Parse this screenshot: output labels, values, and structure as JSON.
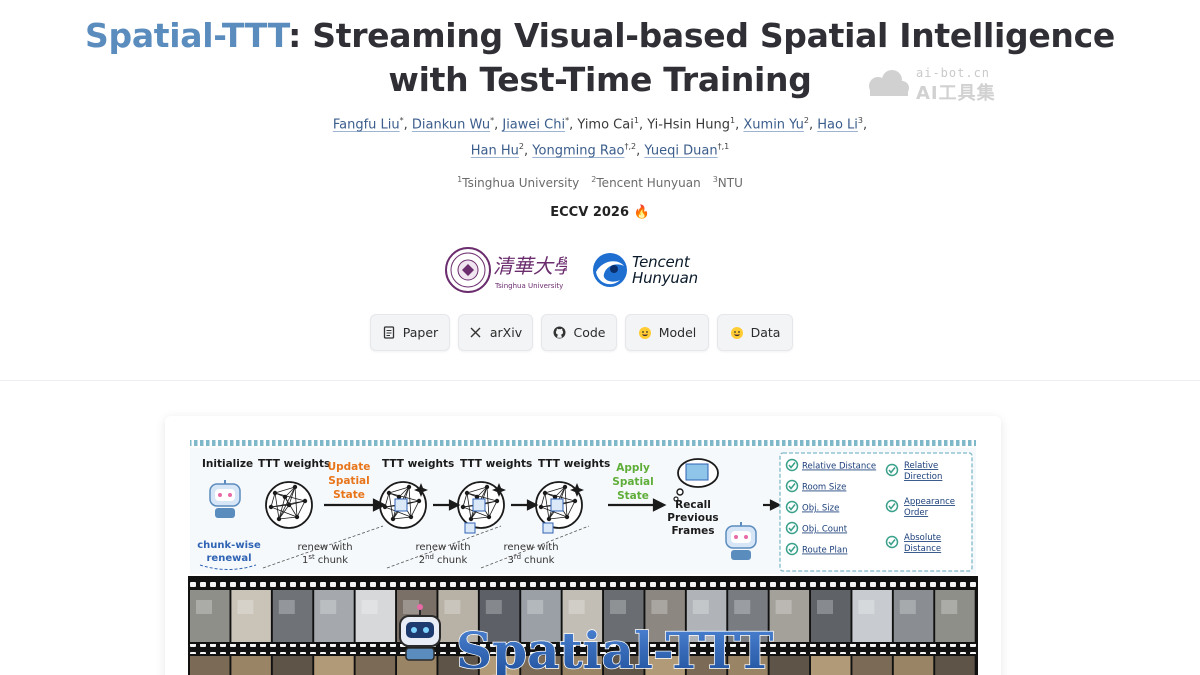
{
  "title": {
    "accent": "Spatial-TTT",
    "rest_line1": ": Streaming Visual-based Spatial Intelligence",
    "line2": "with Test-Time Training"
  },
  "watermark": {
    "line1": "ai-bot.cn",
    "line2": "AI工具集"
  },
  "authors": {
    "line1": [
      {
        "name": "Fangfu Liu",
        "sup": "*",
        "link": true,
        "sep": ", "
      },
      {
        "name": "Diankun Wu",
        "sup": "*",
        "link": true,
        "sep": ", "
      },
      {
        "name": "Jiawei Chi",
        "sup": "*",
        "link": true,
        "sep": ", "
      },
      {
        "name": "Yimo Cai",
        "sup": "1",
        "link": false,
        "sep": ", "
      },
      {
        "name": "Yi-Hsin Hung",
        "sup": "1",
        "link": false,
        "sep": ", "
      },
      {
        "name": "Xumin Yu",
        "sup": "2",
        "link": true,
        "sep": ", "
      },
      {
        "name": "Hao Li",
        "sup": "3",
        "link": true,
        "sep": ","
      }
    ],
    "line2": [
      {
        "name": "Han Hu",
        "sup": "2",
        "link": true,
        "sep": ", "
      },
      {
        "name": "Yongming Rao",
        "sup": "†,2",
        "link": true,
        "sep": ", "
      },
      {
        "name": "Yueqi Duan",
        "sup": "†,1",
        "link": true,
        "sep": ""
      }
    ]
  },
  "affiliations": [
    {
      "sup": "1",
      "name": "Tsinghua University"
    },
    {
      "sup": "2",
      "name": "Tencent Hunyuan"
    },
    {
      "sup": "3",
      "name": "NTU"
    }
  ],
  "venue": "ECCV 2026 🔥",
  "logos": {
    "tsinghua_cn": "清華大學",
    "tsinghua_en": "Tsinghua University",
    "tencent_line1": "Tencent",
    "tencent_line2": "Hunyuan"
  },
  "buttons": [
    {
      "label": "Paper",
      "icon": "document-icon"
    },
    {
      "label": "arXiv",
      "icon": "x-icon"
    },
    {
      "label": "Code",
      "icon": "github-icon"
    },
    {
      "label": "Model",
      "icon": "hugging-face-icon"
    },
    {
      "label": "Data",
      "icon": "hugging-face-icon"
    }
  ],
  "figure": {
    "initialize": "Initialize",
    "ttt_weights": "TTT weights",
    "update_spatial_state": [
      "Update",
      "Spatial",
      "State"
    ],
    "apply_spatial_state": [
      "Apply",
      "Spatial",
      "State"
    ],
    "recall": [
      "Recall",
      "Previous",
      "Frames"
    ],
    "chunk_wise": [
      "chunk-wise",
      "renewal"
    ],
    "renew": [
      {
        "line1": "renew with",
        "ord": "1",
        "ord_sup": "st",
        "line2": "chunk"
      },
      {
        "line1": "renew with",
        "ord": "2",
        "ord_sup": "nd",
        "line2": "chunk"
      },
      {
        "line1": "renew with",
        "ord": "3",
        "ord_sup": "rd",
        "line2": "chunk"
      }
    ],
    "tasks_left": [
      "Relative Distance",
      "Room Size",
      "Obj. Size",
      "Obj. Count",
      "Route Plan"
    ],
    "tasks_right": [
      [
        "Relative",
        "Direction"
      ],
      [
        "Appearance",
        "Order"
      ],
      [
        "Absolute",
        "Distance"
      ]
    ],
    "banner_text": "Spatial-TTT",
    "colors": {
      "accent": "#5b8cbe",
      "orange": "#e8751a",
      "green": "#5fae3a",
      "teal": "#3aa08a",
      "blue_hand": "#2f63b4"
    }
  }
}
